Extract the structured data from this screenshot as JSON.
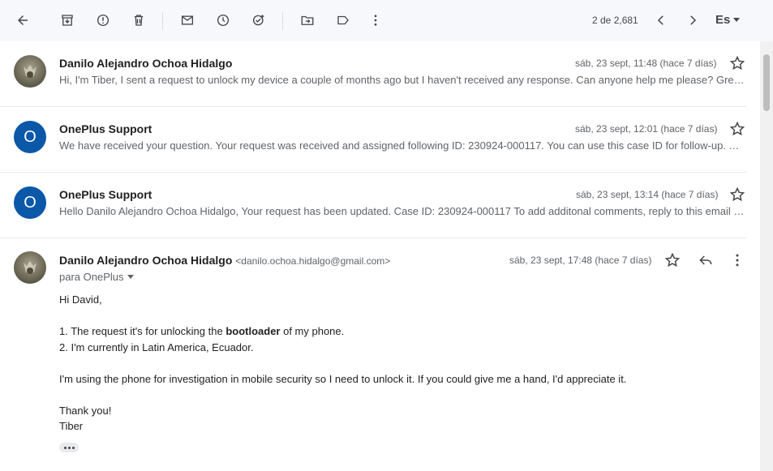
{
  "toolbar": {
    "icons": [
      "back-icon",
      "archive-icon",
      "report-spam-icon",
      "delete-icon",
      "mark-unread-icon",
      "snooze-icon",
      "add-task-icon",
      "move-to-icon",
      "label-icon",
      "more-vert-icon"
    ],
    "pager_text": "2 de 2,681",
    "lang_label": "Es"
  },
  "messages": [
    {
      "sender": "Danilo Alejandro Ochoa Hidalgo",
      "date": "sáb, 23 sept, 11:48 (hace 7 días)",
      "snippet": "Hi, I'm Tiber, I sent a request to unlock my device a couple of months ago but I haven't received any response. Can anyone help me please? Greetings",
      "avatar": "photo"
    },
    {
      "sender": "OnePlus Support",
      "date": "sáb, 23 sept, 12:01 (hace 7 días)",
      "snippet": "We have received your question. Your request was received and assigned following ID: 230924-000117. You can use this case ID for follow-up. Thank you",
      "avatar": "O"
    },
    {
      "sender": "OnePlus Support",
      "date": "sáb, 23 sept, 13:14 (hace 7 días)",
      "snippet": "Hello Danilo Alejandro Ochoa Hidalgo, Your request has been updated. Case ID: 230924-000117 To add additonal comments, reply to this email and include",
      "avatar": "O"
    }
  ],
  "open_message": {
    "sender": "Danilo Alejandro Ochoa Hidalgo",
    "email": "<danilo.ochoa.hidalgo@gmail.com>",
    "date": "sáb, 23 sept, 17:48 (hace 7 días)",
    "to": "para OnePlus",
    "body": {
      "greeting": "Hi David,",
      "line1_pre": "1. The request it's for unlocking the ",
      "line1_bold": "bootloader",
      "line1_post": " of my phone.",
      "line2": "2. I'm currently in Latin America, Ecuador.",
      "line3": "I'm using the phone for investigation in mobile security so I need to unlock it. If you could give me a hand, I'd appreciate it.",
      "thanks": "Thank you!",
      "signature": "Tiber"
    }
  }
}
